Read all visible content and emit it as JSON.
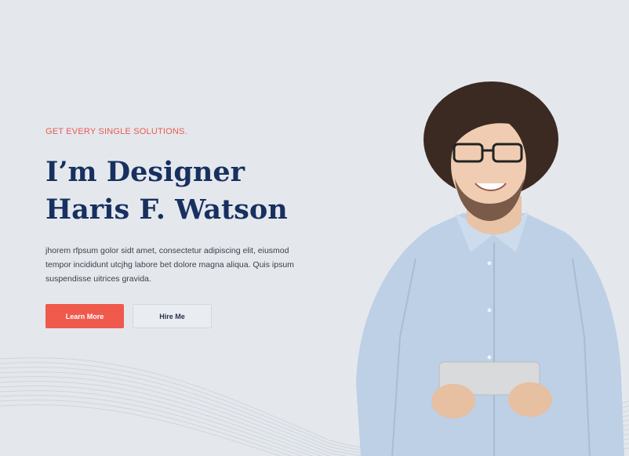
{
  "hero": {
    "tagline": "GET EVERY SINGLE SOLUTIONS.",
    "headline_line1": "I’m Designer",
    "headline_line2": "Haris F. Watson",
    "description": "jhorem rfpsum golor sidt amet, consectetur adipiscing elit, eiusmod tempor incididunt utcjhg labore bet dolore magna aliqua. Quis ipsum suspendisse uitrices gravida.",
    "primary_button_label": "Learn More",
    "secondary_button_label": "Hire Me"
  },
  "colors": {
    "background": "#e4e8ed",
    "accent": "#ef5a4d",
    "heading": "#17305f",
    "body_text": "#3a3f4b"
  },
  "portrait": {
    "subject": "man with curly hair and glasses holding a tablet"
  }
}
